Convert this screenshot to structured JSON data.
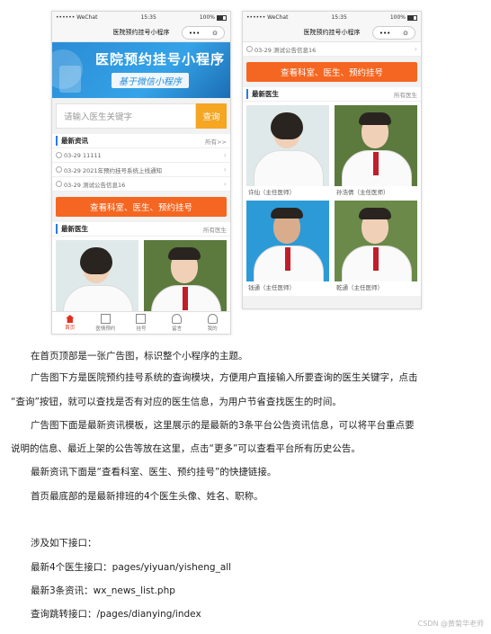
{
  "status_bar": {
    "carrier": "•••••• WeChat",
    "time": "15:35",
    "battery": "100%"
  },
  "mini_program_title": "医院预约挂号小程序",
  "capsule": {
    "more": "•••",
    "close": "⊙"
  },
  "banner": {
    "title": "医院预约挂号小程序",
    "subtitle": "基于微信小程序"
  },
  "search": {
    "placeholder": "请输入医生关键字",
    "button": "查询"
  },
  "news_section": {
    "title": "最新资讯",
    "more": "所有>>",
    "items": [
      "03-29 11111",
      "03-29 2021年预约挂号系统上线通知",
      "03-29 测试公告信息16"
    ]
  },
  "quick_link_button": "查看科室、医生、预约挂号",
  "doctors_section": {
    "title": "最新医生",
    "more": "所有医生",
    "doctors": [
      {
        "name": "许仙（主任医师）"
      },
      {
        "name": "孙浩倩（主任医师）"
      },
      {
        "name": "钱通（主任医师）"
      },
      {
        "name": "乾通（主任医师）"
      }
    ]
  },
  "bottom_nav": [
    {
      "label": "首页",
      "icon": "home-icon"
    },
    {
      "label": "医情预约",
      "icon": "grid-icon"
    },
    {
      "label": "挂号",
      "icon": "check-icon"
    },
    {
      "label": "留言",
      "icon": "user-icon"
    },
    {
      "label": "我的",
      "icon": "user-icon"
    }
  ],
  "document": {
    "paragraphs": [
      "在首页顶部是一张广告图，标识整个小程序的主题。",
      "广告图下方是医院预约挂号系统的查询模块，方便用户直接输入所要查询的医生关键字，点击",
      "“查询”按钮，就可以查找是否有对应的医生信息，为用户节省查找医生的时间。",
      "广告图下面是最新资讯模板，这里展示的是最新的3条平台公告资讯信息，可以将平台重点要",
      "说明的信息、最近上架的公告等放在这里，点击“更多”可以查看平台所有历史公告。",
      "最新资讯下面是“查看科室、医生、预约挂号”的快捷链接。",
      "首页最底部的是最新排班的4个医生头像、姓名、职称。",
      "涉及如下接口：",
      "最新4个医生接口：pages/yiyuan/yisheng_all",
      "最新3条资讯：wx_news_list.php",
      "查询跳转接口：/pages/dianying/index"
    ],
    "watermark": "CSDN @黄菊华老师"
  },
  "colors": {
    "accent_orange": "#f46621",
    "search_orange": "#f5a623",
    "banner_blue": "#2a8cd6",
    "nav_active": "#e0301e"
  }
}
